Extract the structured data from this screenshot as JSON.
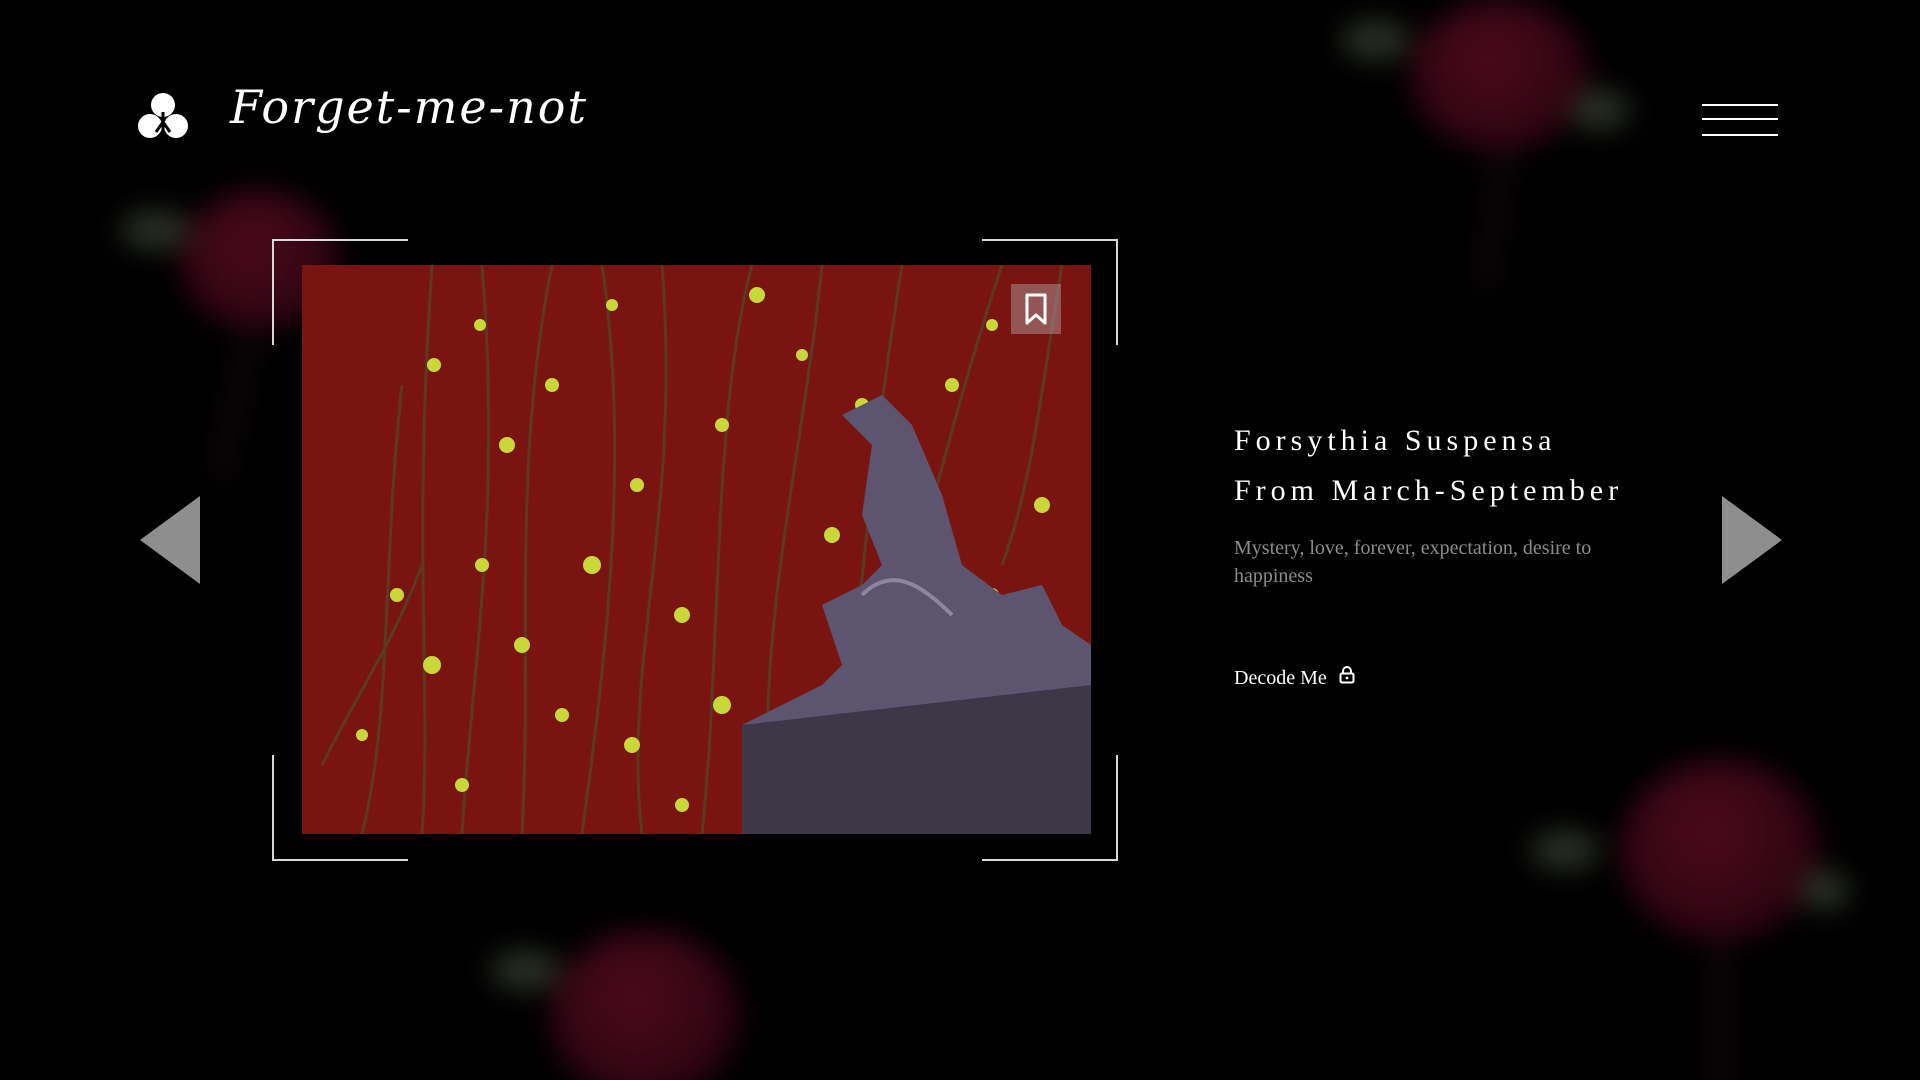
{
  "header": {
    "brand": "Forget-me-not",
    "logo_icon": "clover-logo-icon",
    "menu_icon": "hamburger-menu-icon"
  },
  "navigation": {
    "prev_icon": "triangle-left-icon",
    "next_icon": "triangle-right-icon"
  },
  "gallery": {
    "bookmark_icon": "bookmark-icon",
    "photo_description_icon": "photo"
  },
  "info": {
    "title_line_1": "Forsythia Suspensa",
    "title_line_2": "From March-September",
    "description": "Mystery, love, forever, expectation, desire to happiness",
    "cta_label": "Decode Me",
    "cta_icon": "lock-icon"
  },
  "colors": {
    "background": "#000000",
    "photo_background": "#7a1410",
    "accent_rose": "#8a1236",
    "description_text": "#8c8c8c",
    "arrow": "#8e8e8e"
  }
}
